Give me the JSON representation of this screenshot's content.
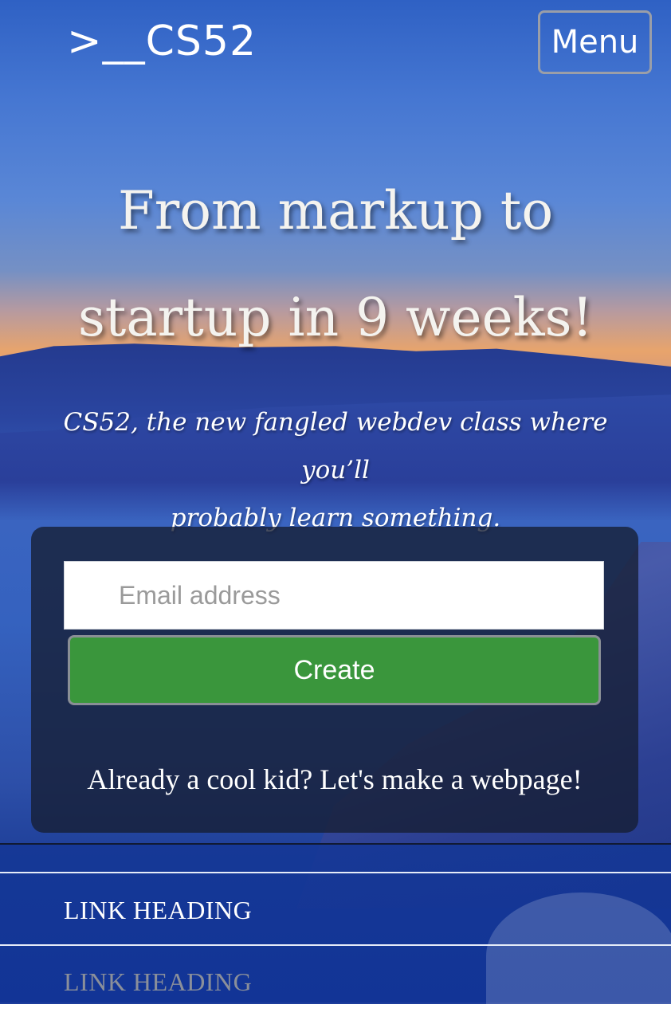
{
  "header": {
    "logo": ">__CS52",
    "menu_label": "Menu"
  },
  "hero": {
    "title_line1": "From markup to",
    "title_line2": "startup in 9 weeks!",
    "subtitle_line1": "CS52, the new fangled webdev class where you’ll",
    "subtitle_line2": "probably learn something."
  },
  "signup": {
    "email_placeholder": "Email address",
    "email_value": "",
    "create_label": "Create",
    "login_link": "Already a cool kid? Let's make a webpage!"
  },
  "nav": {
    "items": [
      {
        "label": "LINK HEADING"
      },
      {
        "label": "LINK HEADING"
      }
    ]
  },
  "colors": {
    "create_button": "#3a963c",
    "card_background": "rgba(22,30,50,0.78)",
    "menu_border": "#9a9ea8",
    "text_primary": "#ffffff",
    "nav_muted": "#8a8f9a"
  }
}
